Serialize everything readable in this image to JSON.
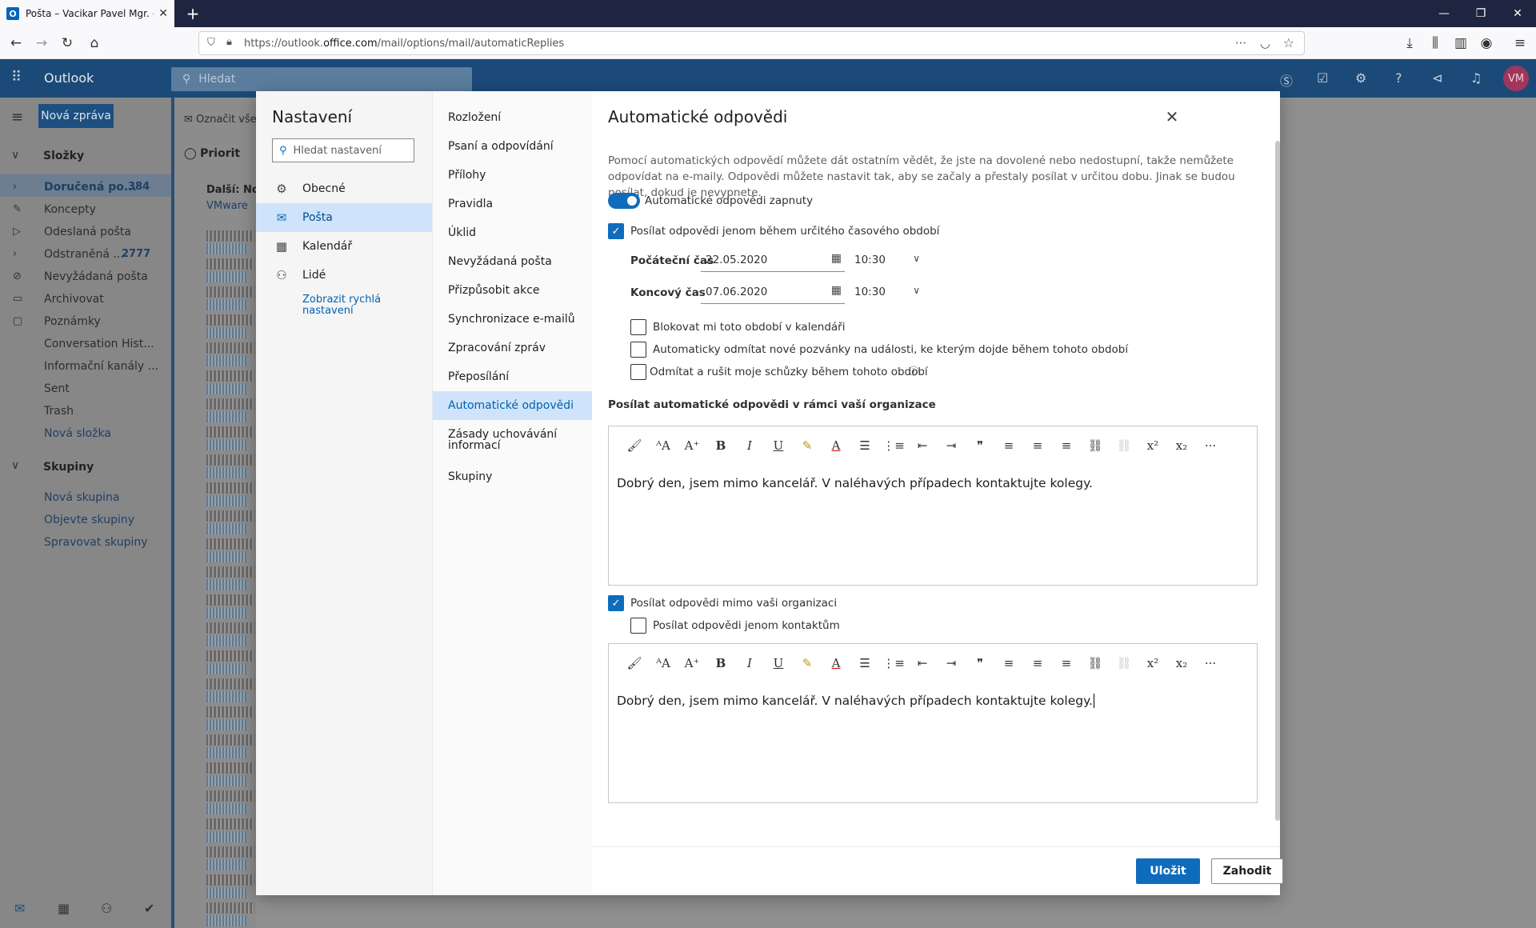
{
  "browser": {
    "tab_title": "Pošta – Vacikar Pavel Mgr. – Outlook",
    "url_prefix": "https://outlook.",
    "url_domain": "office.com",
    "url_path": "/mail/options/mail/automaticReplies"
  },
  "outlook": {
    "brand": "Outlook",
    "search_placeholder": "Hledat",
    "new_message": "Nová zpráva",
    "mark_all": "Označit vše",
    "avatar": "VM",
    "folders_header": "Složky",
    "focused_tab": "Priorit",
    "next_label": "Další: Nov",
    "vmware": "VMware",
    "folders": [
      {
        "label": "Doručená po...",
        "count": "384"
      },
      {
        "label": "Koncepty",
        "count": ""
      },
      {
        "label": "Odeslaná pošta",
        "count": ""
      },
      {
        "label": "Odstraněná ...",
        "count": "2777"
      },
      {
        "label": "Nevyžádaná pošta",
        "count": ""
      },
      {
        "label": "Archivovat",
        "count": ""
      },
      {
        "label": "Poznámky",
        "count": ""
      },
      {
        "label": "Conversation Hist...",
        "count": ""
      },
      {
        "label": "Informační kanály ...",
        "count": ""
      },
      {
        "label": "Sent",
        "count": ""
      },
      {
        "label": "Trash",
        "count": ""
      },
      {
        "label": "Nová složka",
        "count": ""
      }
    ],
    "groups_header": "Skupiny",
    "groups": [
      "Nová skupina",
      "Objevte skupiny",
      "Spravovat skupiny"
    ]
  },
  "settings": {
    "title": "Nastavení",
    "search_placeholder": "Hledat nastavení",
    "categories": [
      "Obecné",
      "Pošta",
      "Kalendář",
      "Lidé"
    ],
    "quick_settings": "Zobrazit rychlá nastavení",
    "subcategories": [
      "Rozložení",
      "Psaní a odpovídání",
      "Přílohy",
      "Pravidla",
      "Úklid",
      "Nevyžádaná pošta",
      "Přizpůsobit akce",
      "Synchronizace e-mailů",
      "Zpracování zpráv",
      "Přeposílání",
      "Automatické odpovědi",
      "Zásady uchovávání informací",
      "Skupiny"
    ]
  },
  "auto": {
    "title": "Automatické odpovědi",
    "description": "Pomocí automatických odpovědí můžete dát ostatním vědět, že jste na dovolené nebo nedostupní, takže nemůžete odpovídat na e-maily. Odpovědi můžete nastavit tak, aby se začaly a přestaly posílat v určitou dobu. Jinak se budou posílat, dokud je nevypnete.",
    "toggle_label": "Automatické odpovědi zapnuty",
    "period_label": "Posílat odpovědi jenom během určitého časového období",
    "start_label": "Počáteční čas",
    "start_date": "22.05.2020",
    "start_time": "10:30",
    "end_label": "Koncový čas",
    "end_date": "07.06.2020",
    "end_time": "10:30",
    "block_calendar": "Blokovat mi toto období v kalendáři",
    "decline_invites": "Automaticky odmítat nové pozvánky na události, ke kterým dojde během tohoto období",
    "cancel_meetings": "Odmítat a rušit moje schůzky během tohoto období",
    "inside_header": "Posílat automatické odpovědi v rámci vaší organizace",
    "inside_text": "Dobrý den, jsem mimo kancelář. V naléhavých případech kontaktujte kolegy.",
    "outside_label": "Posílat odpovědi mimo vaši organizaci",
    "contacts_only": "Posílat odpovědi jenom kontaktům",
    "outside_text": "Dobrý den, jsem mimo kancelář. V naléhavých případech kontaktujte kolegy.",
    "save": "Uložit",
    "discard": "Zahodit"
  }
}
